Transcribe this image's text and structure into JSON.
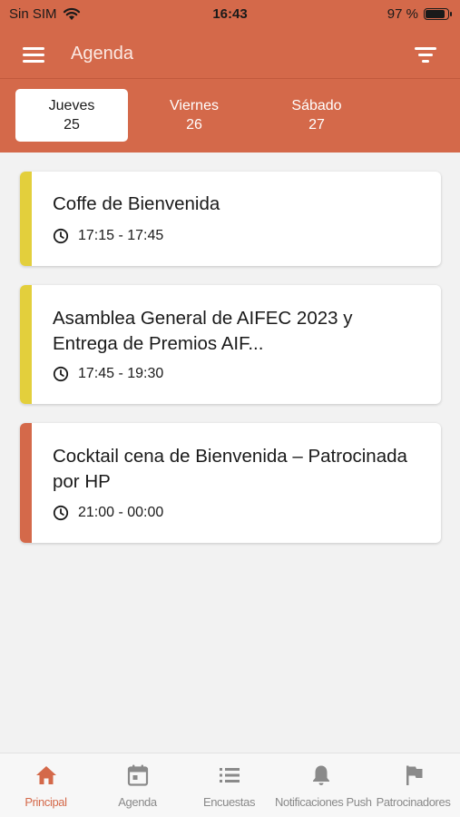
{
  "status_bar": {
    "carrier": "Sin SIM",
    "time": "16:43",
    "battery_text": "97 %",
    "battery_level": 0.97
  },
  "app_bar": {
    "title": "Agenda",
    "menu_icon": "hamburger-menu-icon",
    "filter_icon": "filter-icon"
  },
  "day_tabs": [
    {
      "day": "Jueves",
      "date": "25",
      "active": true
    },
    {
      "day": "Viernes",
      "date": "26",
      "active": false
    },
    {
      "day": "Sábado",
      "date": "27",
      "active": false
    }
  ],
  "events": [
    {
      "title": "Coffe de Bienvenida",
      "time": "17:15 - 17:45",
      "accent": "#e3cf3c"
    },
    {
      "title": "Asamblea General de AIFEC 2023 y Entrega de Premios AIF...",
      "time": "17:45 - 19:30",
      "accent": "#e3cf3c"
    },
    {
      "title": "Cocktail cena de Bienvenida – Patrocinada por HP",
      "time": "21:00 - 00:00",
      "accent": "#d4694a"
    }
  ],
  "tab_bar": [
    {
      "label": "Principal",
      "icon": "home-icon",
      "active": true
    },
    {
      "label": "Agenda",
      "icon": "calendar-icon",
      "active": false
    },
    {
      "label": "Encuestas",
      "icon": "list-icon",
      "active": false
    },
    {
      "label": "Notificaciones Push",
      "icon": "bell-icon",
      "active": false
    },
    {
      "label": "Patrocinadores",
      "icon": "flag-icon",
      "active": false
    }
  ],
  "colors": {
    "brand": "#d4694a",
    "accent_yellow": "#e3cf3c",
    "tab_inactive": "#8a8a8a"
  }
}
